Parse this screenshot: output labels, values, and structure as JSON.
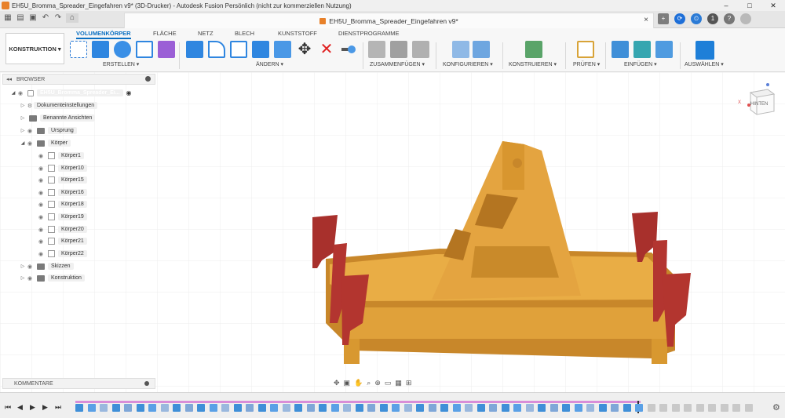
{
  "window": {
    "title": "EH5U_Bromma_Spreader_Eingefahren v9* (3D-Drucker) - Autodesk Fusion Persönlich (nicht zur kommerziellen Nutzung)",
    "controls": [
      "–",
      "□",
      "✕"
    ]
  },
  "document_tab": {
    "label": "EH5U_Bromma_Spreader_Eingefahren v9*",
    "close": "×"
  },
  "tabbar_right": {
    "notifications": "1"
  },
  "ribbon": {
    "workspace": "KONSTRUKTION ▾",
    "tabs": [
      {
        "label": "VOLUMENKÖRPER",
        "active": true
      },
      {
        "label": "FLÄCHE",
        "active": false
      },
      {
        "label": "NETZ",
        "active": false
      },
      {
        "label": "BLECH",
        "active": false
      },
      {
        "label": "KUNSTSTOFF",
        "active": false
      },
      {
        "label": "DIENSTPROGRAMME",
        "active": false
      }
    ],
    "groups": [
      {
        "label": "ERSTELLEN ▾"
      },
      {
        "label": "ÄNDERN ▾"
      },
      {
        "label": "ZUSAMMENFÜGEN ▾"
      },
      {
        "label": "KONFIGURIEREN ▾"
      },
      {
        "label": "KONSTRUIEREN ▾"
      },
      {
        "label": "PRÜFEN ▾"
      },
      {
        "label": "EINFÜGEN ▾"
      },
      {
        "label": "AUSWÄHLEN ▾"
      }
    ]
  },
  "browser": {
    "title": "BROWSER",
    "root": "EH5U_Bromma_Spreader_Ei...",
    "items": [
      {
        "label": "Dokumenteinstellungen"
      },
      {
        "label": "Benannte Ansichten"
      },
      {
        "label": "Ursprung"
      },
      {
        "label": "Körper"
      },
      {
        "label": "Körper1"
      },
      {
        "label": "Körper10"
      },
      {
        "label": "Körper15"
      },
      {
        "label": "Körper16"
      },
      {
        "label": "Körper18"
      },
      {
        "label": "Körper19"
      },
      {
        "label": "Körper20"
      },
      {
        "label": "Körper21"
      },
      {
        "label": "Körper22"
      },
      {
        "label": "Skizzen"
      },
      {
        "label": "Konstruktion"
      }
    ]
  },
  "comments": {
    "title": "KOMMENTARE"
  },
  "viewcube": {
    "face": "HINTEN",
    "axis_x": "X"
  },
  "colors": {
    "accent": "#0a6fc2",
    "model_body": "#e0a13a",
    "model_pads": "#a8302c",
    "timeline": "#d98ed8"
  }
}
